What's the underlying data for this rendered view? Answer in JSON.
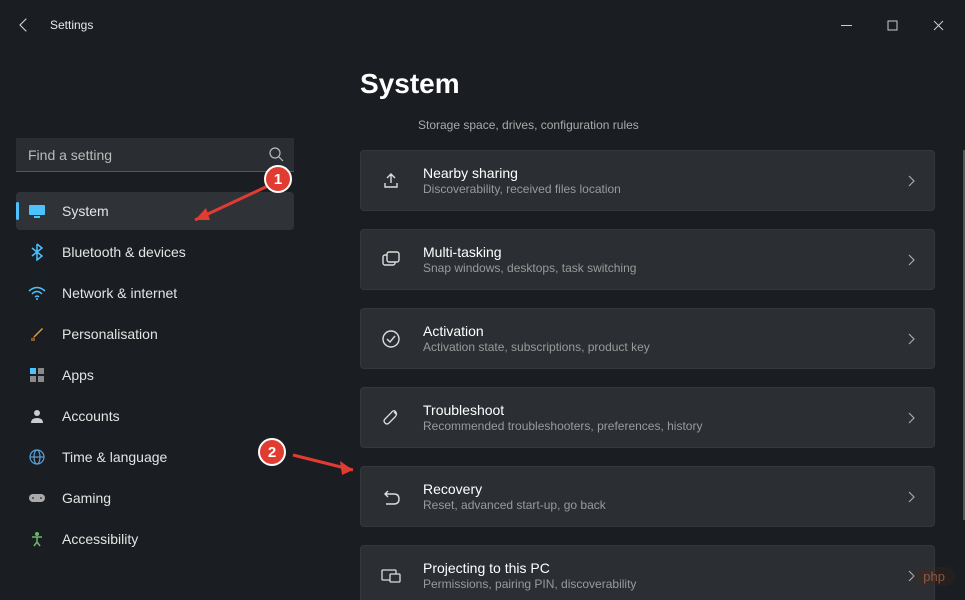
{
  "window": {
    "title": "Settings"
  },
  "search": {
    "placeholder": "Find a setting"
  },
  "sidebar": {
    "items": [
      {
        "label": "System",
        "icon": "display",
        "active": true
      },
      {
        "label": "Bluetooth & devices",
        "icon": "bluetooth"
      },
      {
        "label": "Network & internet",
        "icon": "wifi"
      },
      {
        "label": "Personalisation",
        "icon": "brush"
      },
      {
        "label": "Apps",
        "icon": "apps"
      },
      {
        "label": "Accounts",
        "icon": "person"
      },
      {
        "label": "Time & language",
        "icon": "globe"
      },
      {
        "label": "Gaming",
        "icon": "gamepad"
      },
      {
        "label": "Accessibility",
        "icon": "accessibility"
      }
    ]
  },
  "page": {
    "title": "System",
    "trailing_desc": "Storage space, drives, configuration rules",
    "cards": [
      {
        "title": "Nearby sharing",
        "desc": "Discoverability, received files location",
        "icon": "share"
      },
      {
        "title": "Multi-tasking",
        "desc": "Snap windows, desktops, task switching",
        "icon": "multitask"
      },
      {
        "title": "Activation",
        "desc": "Activation state, subscriptions, product key",
        "icon": "check-circle"
      },
      {
        "title": "Troubleshoot",
        "desc": "Recommended troubleshooters, preferences, history",
        "icon": "wrench"
      },
      {
        "title": "Recovery",
        "desc": "Reset, advanced start-up, go back",
        "icon": "recovery"
      },
      {
        "title": "Projecting to this PC",
        "desc": "Permissions, pairing PIN, discoverability",
        "icon": "project"
      }
    ]
  },
  "annotations": {
    "badge1": "1",
    "badge2": "2"
  },
  "watermark": "php"
}
